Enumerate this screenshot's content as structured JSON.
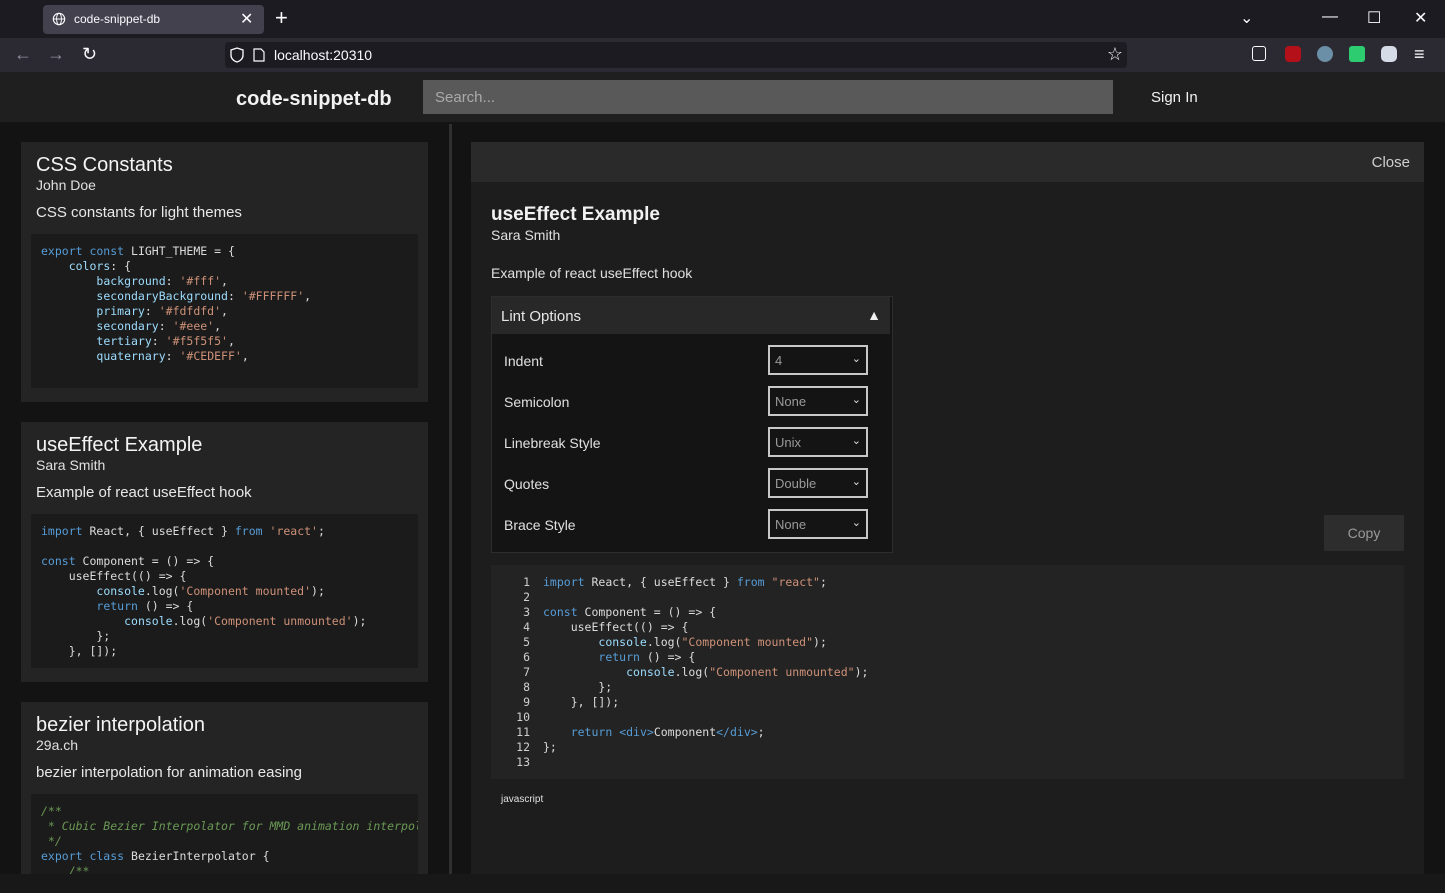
{
  "browser": {
    "tab_title": "code-snippet-db",
    "url": "localhost:20310"
  },
  "app": {
    "brand": "code-snippet-db",
    "search_placeholder": "Search...",
    "signin_label": "Sign In"
  },
  "snippets": [
    {
      "title": "CSS Constants",
      "author": "John Doe",
      "description": "CSS constants for light themes"
    },
    {
      "title": "useEffect Example",
      "author": "Sara Smith",
      "description": "Example of react useEffect hook"
    },
    {
      "title": "bezier interpolation",
      "author": "29a.ch",
      "description": "bezier interpolation for animation easing"
    }
  ],
  "detail": {
    "close_label": "Close",
    "title": "useEffect Example",
    "author": "Sara Smith",
    "description": "Example of react useEffect hook",
    "lint": {
      "heading": "Lint Options",
      "options": [
        {
          "label": "Indent",
          "value": "4"
        },
        {
          "label": "Semicolon",
          "value": "None"
        },
        {
          "label": "Linebreak Style",
          "value": "Unix"
        },
        {
          "label": "Quotes",
          "value": "Double"
        },
        {
          "label": "Brace Style",
          "value": "None"
        }
      ]
    },
    "copy_label": "Copy",
    "language": "javascript"
  }
}
